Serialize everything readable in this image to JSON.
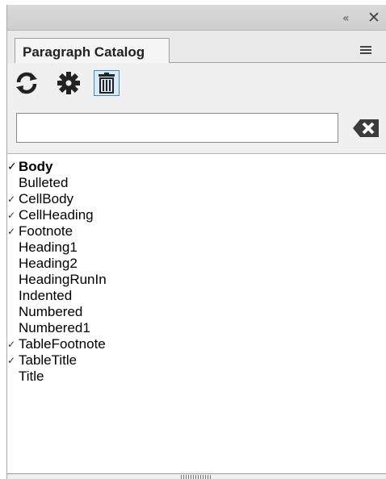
{
  "window": {
    "collapse_glyph": "«",
    "close_glyph": "✕"
  },
  "tab": {
    "label": "Paragraph Catalog"
  },
  "toolbar": {
    "icons": [
      "refresh-icon",
      "settings-icon",
      "delete-icon"
    ]
  },
  "search": {
    "value": "",
    "placeholder": ""
  },
  "catalog": {
    "items": [
      {
        "label": "Body",
        "checked": true,
        "current": true
      },
      {
        "label": "Bulleted",
        "checked": false
      },
      {
        "label": "CellBody",
        "checked": true
      },
      {
        "label": "CellHeading",
        "checked": true
      },
      {
        "label": "Footnote",
        "checked": true
      },
      {
        "label": "Heading1",
        "checked": false
      },
      {
        "label": "Heading2",
        "checked": false
      },
      {
        "label": "HeadingRunIn",
        "checked": false
      },
      {
        "label": "Indented",
        "checked": false
      },
      {
        "label": "Numbered",
        "checked": false
      },
      {
        "label": "Numbered1",
        "checked": false
      },
      {
        "label": "TableFootnote",
        "checked": true
      },
      {
        "label": "TableTitle",
        "checked": true
      },
      {
        "label": "Title",
        "checked": false
      }
    ]
  },
  "colors": {
    "accent": "#3a8ad0",
    "panel": "#f0f0f0"
  }
}
